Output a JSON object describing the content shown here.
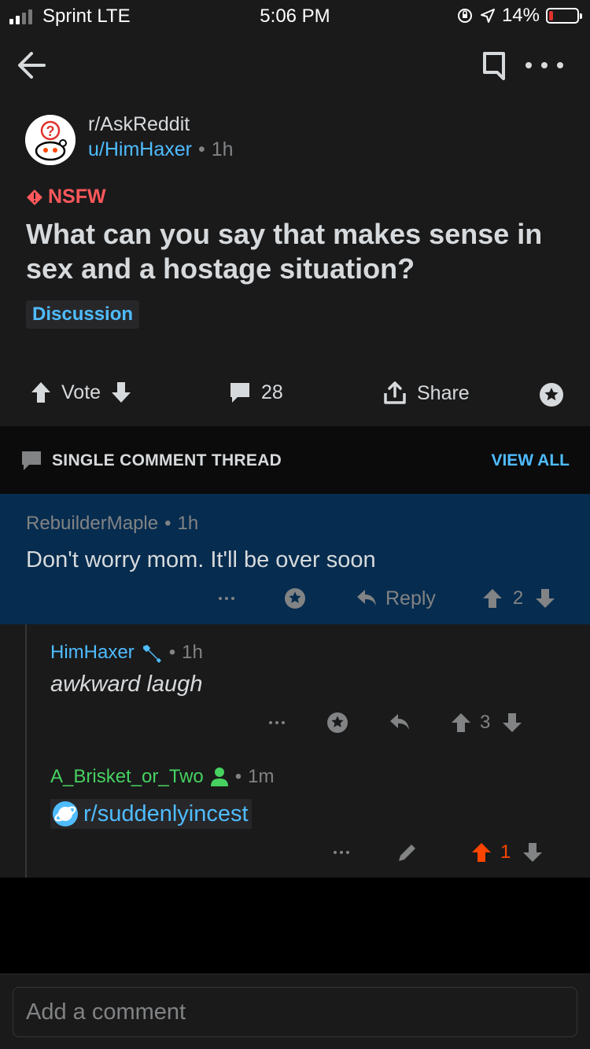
{
  "status_bar": {
    "carrier": "Sprint LTE",
    "time": "5:06 PM",
    "battery": "14%",
    "battery_level": 0.14,
    "battery_color": "#e0332e"
  },
  "post": {
    "subreddit": "r/AskReddit",
    "author": "u/HimHaxer",
    "separator": "•",
    "age": "1h",
    "nsfw_label": "NSFW",
    "title": "What can you say that makes sense in sex and a hostage situation?",
    "flair": "Discussion",
    "vote_label": "Vote",
    "comment_count": "28",
    "share_label": "Share"
  },
  "thread": {
    "banner_label": "SINGLE COMMENT THREAD",
    "view_all": "VIEW ALL"
  },
  "comments": [
    {
      "author": "RebuilderMaple",
      "separator": "•",
      "age": "1h",
      "body": "Don't worry mom. It'll be over soon",
      "reply_label": "Reply",
      "score": "2"
    },
    {
      "author": "HimHaxer",
      "separator": "•",
      "age": "1h",
      "body": "awkward laugh",
      "score": "3"
    },
    {
      "author": "A_Brisket_or_Two",
      "separator": "•",
      "age": "1m",
      "body": "r/suddenlyincest",
      "score": "1"
    }
  ],
  "composer": {
    "placeholder": "Add a comment"
  },
  "colors": {
    "background": "#1a1a1b",
    "highlight": "#062c4f",
    "accent_blue": "#4fbcff",
    "nsfw_red": "#ff585b",
    "upvote_orange": "#ff4500",
    "op_green": "#46d160"
  },
  "icons": [
    "back-arrow-icon",
    "bookmark-icon",
    "more-icon",
    "alien-avatar-icon",
    "nsfw-icon",
    "upvote-icon",
    "downvote-icon",
    "comment-icon",
    "share-icon",
    "award-icon",
    "reply-icon",
    "edit-icon",
    "mod-wrench-icon",
    "person-icon",
    "subreddit-icon"
  ]
}
